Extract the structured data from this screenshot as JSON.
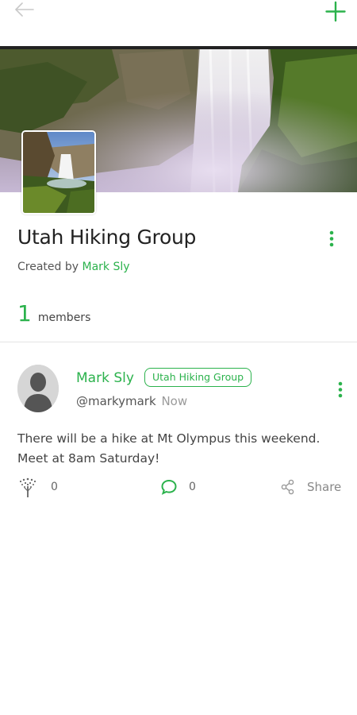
{
  "nav": {
    "back_icon": "arrow-left-icon",
    "add_icon": "plus-icon",
    "accent": "#2bb24c"
  },
  "group": {
    "title": "Utah Hiking Group",
    "created_prefix": "Created by",
    "creator": "Mark Sly",
    "member_count": "1",
    "member_label": "members"
  },
  "post": {
    "author": "Mark Sly",
    "group_tag": "Utah Hiking Group",
    "handle": "@markymark",
    "time": "Now",
    "body_line1": "There will be a hike at Mt Olympus this weekend.",
    "body_line2": "Meet at 8am Saturday!",
    "likes": "0",
    "comments": "0",
    "share_label": "Share"
  },
  "colors": {
    "accent": "#2bb24c",
    "text": "#333333",
    "muted": "#9a9a9a"
  }
}
